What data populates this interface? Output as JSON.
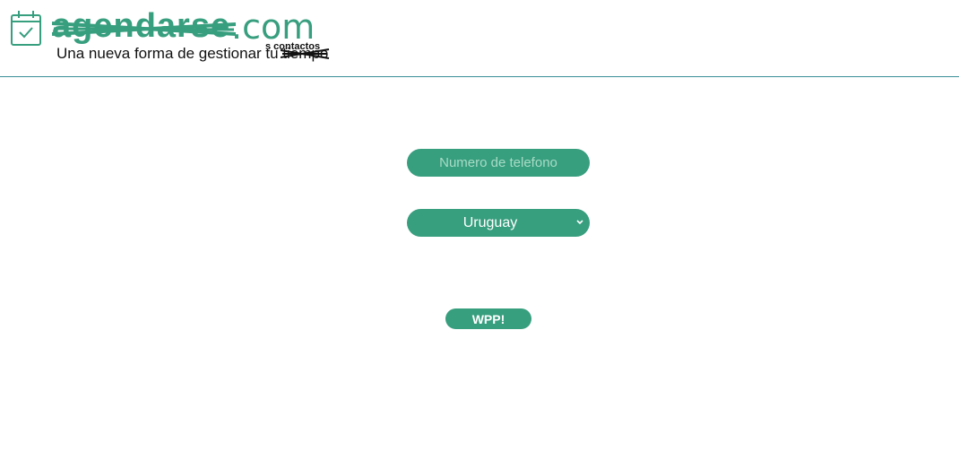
{
  "header": {
    "brand_struck": "agendarse",
    "brand_suffix": ".com",
    "tagline_prefix": "Una nueva forma de gestionar tu ",
    "tagline_struck": "tiempo",
    "tagline_replacement": "s contactos",
    "logo_icon": "calendar-check-icon"
  },
  "form": {
    "phone_placeholder": "Numero de telefono",
    "phone_value": "",
    "country_selected": "Uruguay",
    "submit_label": "WPP!"
  },
  "colors": {
    "accent": "#379e7e",
    "divider": "#3a8f97",
    "placeholder": "#a8dcc6"
  }
}
